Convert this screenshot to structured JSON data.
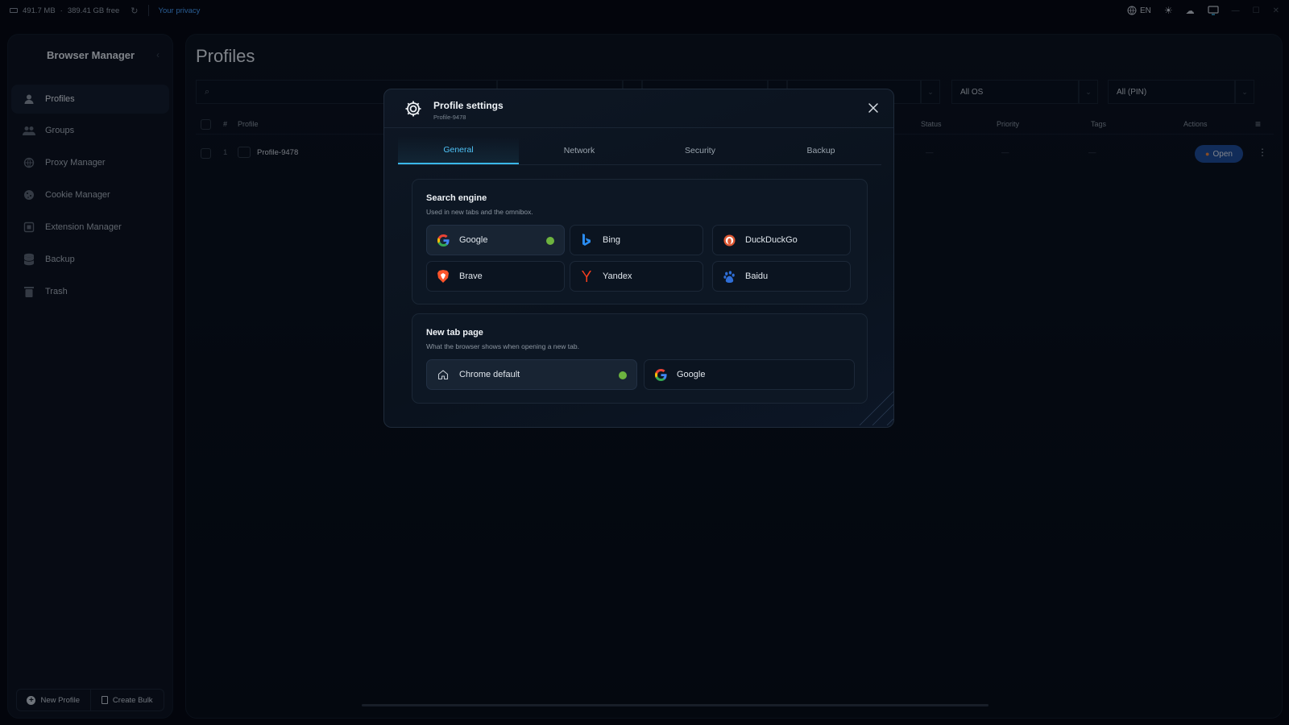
{
  "topbar": {
    "memory": "491.7 MB",
    "disk": "389.41 GB free",
    "privacy_link": "Your privacy",
    "language": "EN"
  },
  "sidebar": {
    "title": "Browser Manager",
    "items": [
      {
        "label": "Profiles",
        "icon": "user-icon"
      },
      {
        "label": "Groups",
        "icon": "users-icon"
      },
      {
        "label": "Proxy Manager",
        "icon": "proxy-icon"
      },
      {
        "label": "Cookie Manager",
        "icon": "cookie-icon"
      },
      {
        "label": "Extension Manager",
        "icon": "puzzle-icon"
      },
      {
        "label": "Backup",
        "icon": "database-icon"
      },
      {
        "label": "Trash",
        "icon": "trash-icon"
      }
    ],
    "footer": {
      "new_profile": "New Profile",
      "create_bulk": "Create Bulk"
    }
  },
  "main": {
    "title": "Profiles",
    "filters": {
      "os": "All OS",
      "pin": "All (PIN)"
    },
    "columns": {
      "num": "#",
      "profile": "Profile",
      "status": "Status",
      "priority": "Priority",
      "tags": "Tags",
      "actions": "Actions"
    },
    "rows": [
      {
        "num": "1",
        "name": "Profile-9478",
        "status": "—",
        "priority": "—",
        "tags": "—",
        "open": "Open"
      }
    ]
  },
  "modal": {
    "title": "Profile settings",
    "subtitle": "Profile-9478",
    "tabs": [
      "General",
      "Network",
      "Security",
      "Backup"
    ],
    "search_engine": {
      "title": "Search engine",
      "subtitle": "Used in new tabs and the omnibox.",
      "options": [
        "Google",
        "Bing",
        "DuckDuckGo",
        "Brave",
        "Yandex",
        "Baidu"
      ],
      "selected": "Google"
    },
    "new_tab": {
      "title": "New tab page",
      "subtitle": "What the browser shows when opening a new tab.",
      "options": [
        "Chrome default",
        "Google"
      ],
      "selected": "Chrome default"
    }
  },
  "colors": {
    "accent": "#3ab7e8",
    "selected_dot": "#6db33f",
    "open_button": "#1e4d9a"
  }
}
